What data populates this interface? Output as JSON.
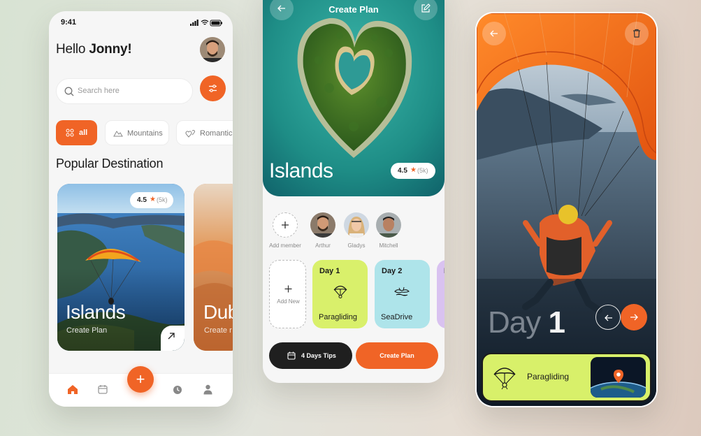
{
  "screen1": {
    "status_time": "9:41",
    "greeting_prefix": "Hello ",
    "greeting_name": "Jonny!",
    "search_placeholder": "Search here",
    "chips": [
      "all",
      "Mountains",
      "Romantic"
    ],
    "section_title": "Popular Destination",
    "cards": [
      {
        "title": "Islands",
        "subtitle": "Create Plan",
        "rating": "4.5",
        "reviews": "(5k)"
      },
      {
        "title": "Dub",
        "subtitle": "Create r"
      }
    ],
    "nav_items": [
      "home-icon",
      "calendar-icon",
      "add-icon",
      "clock-icon",
      "profile-icon"
    ]
  },
  "screen2": {
    "title": "Create Plan",
    "hero_title": "Islands",
    "rating": "4.5",
    "reviews": "(5k)",
    "members": [
      {
        "name": "Add member"
      },
      {
        "name": "Arthur"
      },
      {
        "name": "Gladys"
      },
      {
        "name": "Mitchell"
      }
    ],
    "add_new_label": "Add New",
    "days": [
      {
        "title": "Day 1",
        "activity": "Paragliding",
        "color": "#d9f06b"
      },
      {
        "title": "Day 2",
        "activity": "SeaDrive",
        "color": "#aee4ea"
      },
      {
        "title": "D",
        "activity": "",
        "color": "#d9c2f0"
      }
    ],
    "tips_button": "4 Days Tips",
    "create_button": "Create Plan"
  },
  "screen3": {
    "day_word": "Day ",
    "day_number": "1",
    "activity": "Paragliding"
  },
  "colors": {
    "accent": "#f06426",
    "lime": "#d8f06a"
  }
}
